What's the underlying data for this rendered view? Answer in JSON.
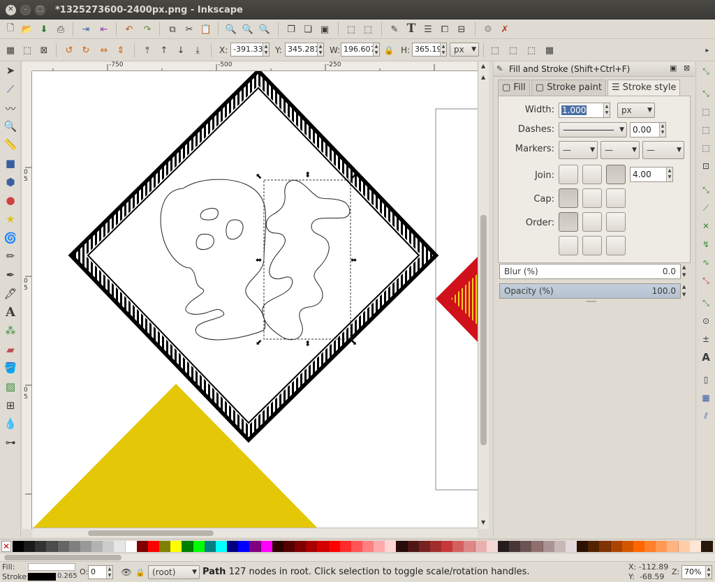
{
  "window": {
    "title": "*1325273600-2400px.png - Inkscape"
  },
  "commands": {
    "icons": [
      "new-icon",
      "open-icon",
      "save-icon",
      "print-icon",
      "import-icon",
      "export-icon",
      "undo-icon",
      "redo-icon",
      "copy-icon",
      "cut-icon",
      "paste-icon",
      "zoom-selection-icon",
      "zoom-drawing-icon",
      "zoom-page-icon",
      "duplicate-icon",
      "clone-icon",
      "unlink-clone-icon",
      "group-icon",
      "ungroup-icon",
      "fill-stroke-icon",
      "text-font-icon",
      "layers-icon",
      "xml-editor-icon",
      "align-icon",
      "preferences-icon",
      "document-properties-icon"
    ]
  },
  "controls": {
    "x_label": "X:",
    "x_value": "-391.336",
    "y_label": "Y:",
    "y_value": "345.281",
    "w_label": "W:",
    "w_value": "196.607",
    "h_label": "H:",
    "h_value": "365.198",
    "unit": "px"
  },
  "ruler": {
    "h_labels": [
      "-750",
      "-500",
      "-250"
    ],
    "v_labels": [
      "0",
      "5",
      "0",
      "5",
      "0",
      "5"
    ]
  },
  "panel": {
    "title": "Fill and Stroke (Shift+Ctrl+F)",
    "tabs": [
      "Fill",
      "Stroke paint",
      "Stroke style"
    ],
    "active_tab": "Stroke style",
    "width_label": "Width:",
    "width_value": "1.000",
    "width_unit": "px",
    "dashes_label": "Dashes:",
    "dashes_value": "0.00",
    "markers_label": "Markers:",
    "join_label": "Join:",
    "join_value": "4.00",
    "cap_label": "Cap:",
    "order_label": "Order:",
    "blur_label": "Blur (%)",
    "blur_value": "0.0",
    "opacity_label": "Opacity (%)",
    "opacity_value": "100.0"
  },
  "status": {
    "fill_label": "Fill:",
    "stroke_label": "Stroke:",
    "stroke_width": "0.265",
    "opacity_label": "O:",
    "opacity_value": "0",
    "layer": "(root)",
    "message_bold": "Path",
    "message": "127 nodes in root. Click selection to toggle scale/rotation handles.",
    "cursor_x": "X: -112.89",
    "cursor_y": "Y:  -68.59",
    "zoom_label": "Z:",
    "zoom_value": "70%"
  },
  "palette": {
    "colors": [
      "#000000",
      "#1a1a1a",
      "#333333",
      "#4d4d4d",
      "#666666",
      "#808080",
      "#999999",
      "#b3b3b3",
      "#cccccc",
      "#e6e6e6",
      "#ffffff",
      "#800000",
      "#ff0000",
      "#808000",
      "#ffff00",
      "#008000",
      "#00ff00",
      "#008080",
      "#00ffff",
      "#000080",
      "#0000ff",
      "#800080",
      "#ff00ff",
      "#2b0000",
      "#550000",
      "#800000",
      "#aa0000",
      "#d40000",
      "#ff0000",
      "#ff2a2a",
      "#ff5555",
      "#ff8080",
      "#ffaaaa",
      "#ffd5d5",
      "#280b0b",
      "#501616",
      "#782121",
      "#a02c2c",
      "#c83737",
      "#d35f5f",
      "#de8787",
      "#e9afaf",
      "#f4d7d7",
      "#241c1c",
      "#483737",
      "#6c5353",
      "#916f6f",
      "#ac9393",
      "#c8b7b7",
      "#e3dbdb",
      "#2b1100",
      "#552200",
      "#803300",
      "#aa4400",
      "#d45500",
      "#ff6600",
      "#ff7f2a",
      "#ff9955",
      "#ffb380",
      "#ffccaa",
      "#ffe6d5",
      "#28170b"
    ]
  }
}
